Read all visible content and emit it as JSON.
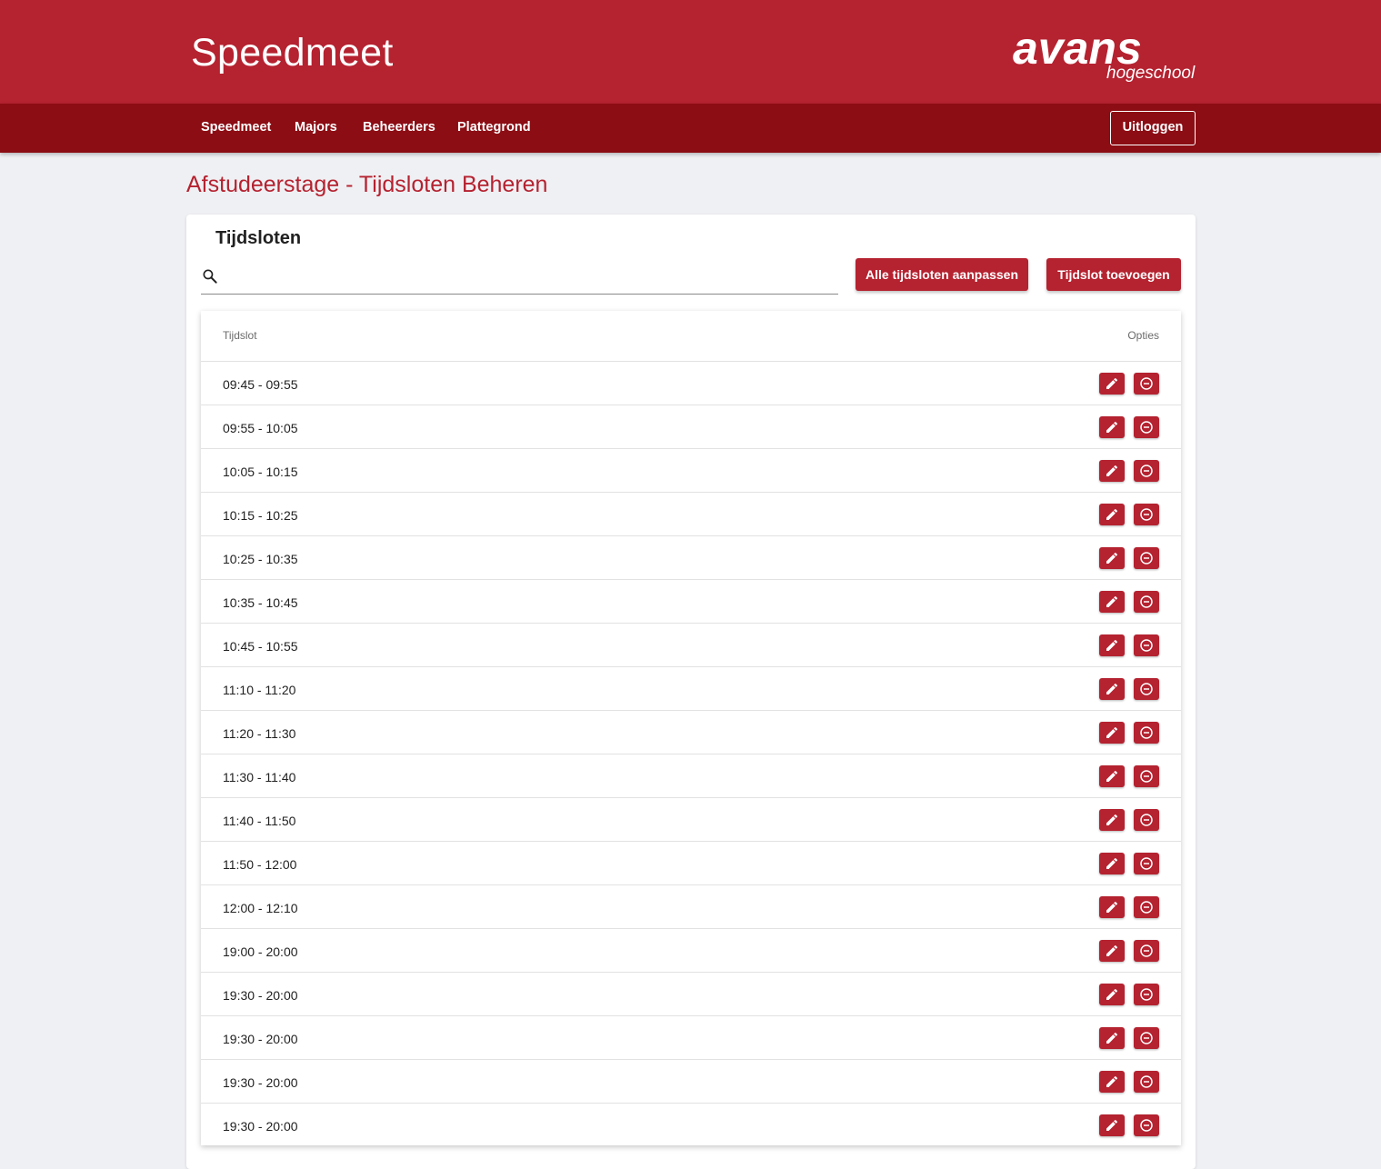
{
  "app": {
    "title": "Speedmeet",
    "logo_main": "avans",
    "logo_sub": "hogeschool"
  },
  "nav": {
    "items": [
      "Speedmeet",
      "Majors",
      "Beheerders",
      "Plattegrond"
    ],
    "logout_label": "Uitloggen"
  },
  "page": {
    "title": "Afstudeerstage - Tijdsloten Beheren"
  },
  "card": {
    "title": "Tijdsloten",
    "search_placeholder": "",
    "btn_edit_all": "Alle tijdsloten aanpassen",
    "btn_add": "Tijdslot toevoegen"
  },
  "table": {
    "columns": [
      "Tijdslot",
      "Opties"
    ],
    "rows": [
      "09:45 - 09:55",
      "09:55 - 10:05",
      "10:05 - 10:15",
      "10:15 - 10:25",
      "10:25 - 10:35",
      "10:35 - 10:45",
      "10:45 - 10:55",
      "11:10 - 11:20",
      "11:20 - 11:30",
      "11:30 - 11:40",
      "11:40 - 11:50",
      "11:50 - 12:00",
      "12:00 - 12:10",
      "19:00 - 20:00",
      "19:30 - 20:00",
      "19:30 - 20:00",
      "19:30 - 20:00",
      "19:30 - 20:00"
    ],
    "row_actions": [
      "pencil-icon",
      "remove-circle-icon"
    ]
  },
  "colors": {
    "header": "#b52230",
    "navbar": "#8c0d14",
    "accent": "#b52230",
    "page_bg": "#eff0f3"
  }
}
